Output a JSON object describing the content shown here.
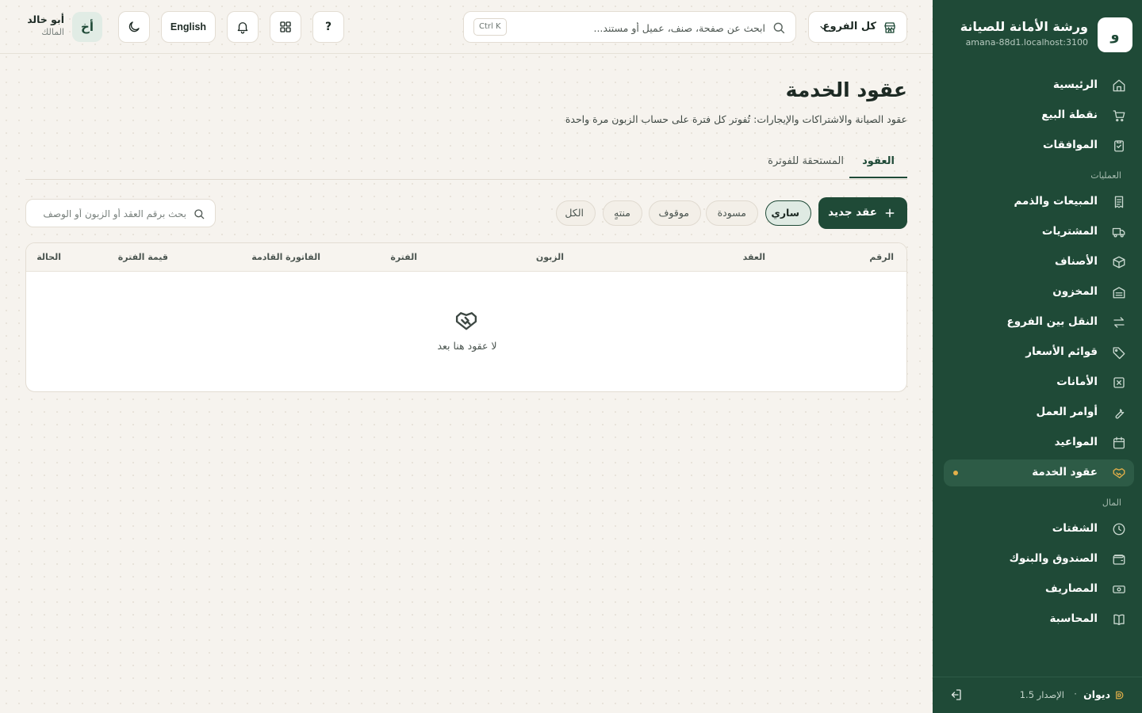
{
  "org": {
    "logo_letter": "و",
    "name": "ورشة الأمانة للصيانة",
    "host": "amana-88d1.localhost:3100"
  },
  "sidebar": {
    "items": [
      {
        "label": "الرئيسية",
        "icon": "home-icon"
      },
      {
        "label": "نقطة البيع",
        "icon": "cart-icon"
      },
      {
        "label": "الموافقات",
        "icon": "clipboard-check-icon"
      }
    ],
    "section_operations": "العمليات",
    "operations": [
      {
        "label": "المبيعات والذمم",
        "icon": "receipt-icon"
      },
      {
        "label": "المشتريات",
        "icon": "truck-icon"
      },
      {
        "label": "الأصناف",
        "icon": "box-icon"
      },
      {
        "label": "المخزون",
        "icon": "warehouse-icon"
      },
      {
        "label": "النقل بين الفروع",
        "icon": "transfer-icon"
      },
      {
        "label": "قوائم الأسعار",
        "icon": "tag-icon"
      },
      {
        "label": "الأمانات",
        "icon": "consignment-icon"
      },
      {
        "label": "أوامر العمل",
        "icon": "wrench-icon"
      },
      {
        "label": "المواعيد",
        "icon": "calendar-icon"
      },
      {
        "label": "عقود الخدمة",
        "icon": "handshake-icon",
        "active": true
      }
    ],
    "section_money": "المال",
    "money": [
      {
        "label": "الشفتات",
        "icon": "clock-icon"
      },
      {
        "label": "الصندوق والبنوك",
        "icon": "wallet-icon"
      },
      {
        "label": "المصاريف",
        "icon": "banknote-icon"
      },
      {
        "label": "المحاسبة",
        "icon": "book-icon"
      }
    ],
    "footer": {
      "brand": "ديوان",
      "separator": "·",
      "version": "الإصدار 1.5"
    }
  },
  "topbar": {
    "branch_label": "كل الفروع",
    "search_placeholder": "ابحث عن صفحة، صنف، عميل أو مستند...",
    "search_shortcut": "Ctrl K",
    "help_label": "?",
    "language_label": "English",
    "user": {
      "initials": "أخ",
      "name": "أبو خالد",
      "role": "المالك"
    }
  },
  "page": {
    "title": "عقود الخدمة",
    "subtitle": "عقود الصيانة والاشتراكات والإيجارات: تُفوتر كل فترة على حساب الزبون مرة واحدة",
    "tabs": [
      "العقود",
      "المستحقة للفوترة"
    ],
    "new_button": "عقد جديد",
    "filters": [
      "ساري",
      "مسودة",
      "موقوف",
      "منتهٍ",
      "الكل"
    ],
    "active_filter": "ساري",
    "table_search_placeholder": "بحث برقم العقد أو الزبون أو الوصف",
    "columns": [
      "الرقم",
      "العقد",
      "الزبون",
      "الفترة",
      "الفاتورة القادمة",
      "قيمة الفترة",
      "الحالة"
    ],
    "empty_text": "لا عقود هنا بعد"
  },
  "colors": {
    "sidebar_bg": "#1f4a37",
    "accent": "#e4b04a",
    "page_bg": "#f6f3ee"
  }
}
